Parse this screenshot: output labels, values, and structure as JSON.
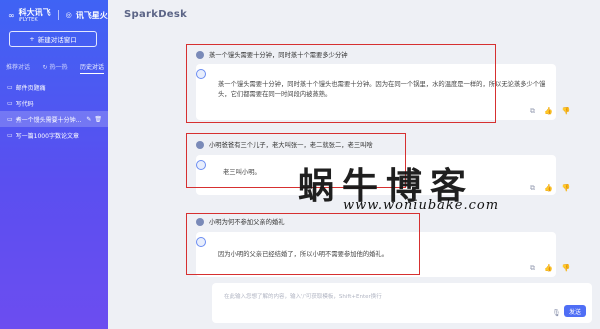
{
  "sidebar": {
    "logo_left": "科大讯飞",
    "logo_left_sub": "iFLYTEK",
    "logo_right": "讯飞星火",
    "new_chat_label": "新建对话窗口",
    "tabs": [
      "推荐对话",
      "热一热",
      "历史对话"
    ],
    "history": [
      {
        "label": "邮件页题痛"
      },
      {
        "label": "写代码"
      },
      {
        "label": "煮一个馒头需要十分钟..."
      },
      {
        "label": "写一篇1000字数论文章"
      }
    ]
  },
  "main": {
    "brand": "SparkDesk",
    "conversations": [
      {
        "question": "蒸一个馒头需要十分钟，同时蒸十个需要多少分钟",
        "answer_line1": "蒸一个馒头需要十分钟，同时蒸十个馒头也需要十分钟。因为在同一个锅里，水的温度是一样的，所以无论蒸多少个馒",
        "answer_line2": "头，它们都需要在同一时间段内被蒸熟。"
      },
      {
        "question": "小明爸爸有三个儿子，老大叫张一，老二就张二，老三叫啥",
        "answer_line1": "老三叫小明。"
      },
      {
        "question": "小明为何不参加父亲的婚礼",
        "answer_line1": "因为小明的父亲已经结婚了，所以小明不需要参加他的婚礼。"
      }
    ],
    "input_placeholder": "在此输入您想了解的内容，输入'/'可获取模板，Shift+Enter换行",
    "send_label": "发送"
  },
  "watermark": {
    "main": "蜗牛博客",
    "sub": "www.woniubake.com"
  },
  "colors": {
    "accent": "#4f6ef5",
    "highlight": "#d63030",
    "sidebar_top": "#3f63f4",
    "sidebar_bottom": "#6c4df0"
  }
}
